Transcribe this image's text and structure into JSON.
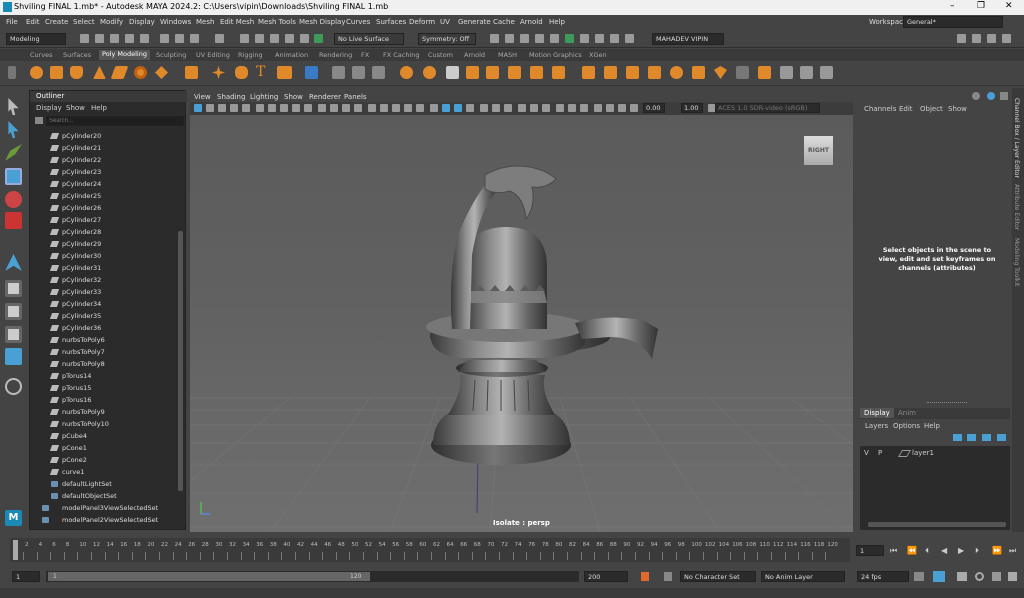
{
  "window": {
    "title": "Shviling FINAL 1.mb* - Autodesk MAYA 2024.2: C:\\Users\\vipin\\Downloads\\Shviling FINAL 1.mb",
    "minimize": "–",
    "maximize": "❐",
    "close": "✕"
  },
  "menu": [
    "File",
    "Edit",
    "Create",
    "Select",
    "Modify",
    "Display",
    "Windows",
    "Mesh",
    "Edit Mesh",
    "Mesh Tools",
    "Mesh Display",
    "Curves",
    "Surfaces",
    "Deform",
    "UV",
    "Generate",
    "Cache",
    "Arnold",
    "Help"
  ],
  "workspace": {
    "label": "Workspace:",
    "value": "General*"
  },
  "statusline": {
    "mode": "Modeling",
    "live_surface": "No Live Surface",
    "symmetry": "Symmetry: Off",
    "user": "MAHADEV VIPIN"
  },
  "shelf_tabs": [
    "Curves",
    "Surfaces",
    "Poly Modeling",
    "Sculpting",
    "UV Editing",
    "Rigging",
    "Animation",
    "Rendering",
    "FX",
    "FX Caching",
    "Custom",
    "Arnold",
    "MASH",
    "Motion Graphics",
    "XGen"
  ],
  "active_shelf": "Poly Modeling",
  "outliner": {
    "title": "Outliner",
    "menu": [
      "Display",
      "Show",
      "Help"
    ],
    "search_placeholder": "Search...",
    "items": [
      "pCylinder20",
      "pCylinder21",
      "pCylinder22",
      "pCylinder23",
      "pCylinder24",
      "pCylinder25",
      "pCylinder26",
      "pCylinder27",
      "pCylinder28",
      "pCylinder29",
      "pCylinder30",
      "pCylinder31",
      "pCylinder32",
      "pCylinder33",
      "pCylinder34",
      "pCylinder35",
      "pCylinder36",
      "nurbsToPoly6",
      "nurbsToPoly7",
      "nurbsToPoly8",
      "pTorus14",
      "pTorus15",
      "pTorus16",
      "nurbsToPoly9",
      "nurbsToPoly10",
      "pCube4",
      "pCone1",
      "pCone2",
      "curve1",
      "defaultLightSet",
      "defaultObjectSet",
      "modelPanel3ViewSelectedSet",
      "modelPanel2ViewSelectedSet"
    ]
  },
  "viewport": {
    "menu": [
      "View",
      "Shading",
      "Lighting",
      "Show",
      "Renderer",
      "Panels"
    ],
    "exposure": "0.00",
    "gamma": "1.00",
    "color_space": "ACES 1.0 SDR-video (sRGB)",
    "view_cube_label": "RIGHT",
    "isolate_label": "Isolate : persp"
  },
  "channel_box": {
    "menu": [
      "Channels",
      "Edit",
      "Object",
      "Show"
    ],
    "empty_message": "Select objects in the scene to view, edit and set keyframes on channels (attributes)"
  },
  "side_tabs": [
    "Channel Box / Layer Editor",
    "Attribute Editor",
    "Modeling Toolkit"
  ],
  "layer_editor": {
    "tabs": [
      "Display",
      "Anim"
    ],
    "active_tab": "Display",
    "menu": [
      "Layers",
      "Options",
      "Help"
    ],
    "layers": [
      {
        "v": "V",
        "p": "P",
        "name": "layer1"
      }
    ]
  },
  "timeline": {
    "ticks": [
      "2",
      "4",
      "6",
      "8",
      "10",
      "12",
      "14",
      "16",
      "18",
      "20",
      "22",
      "24",
      "26",
      "28",
      "30",
      "32",
      "34",
      "36",
      "38",
      "40",
      "42",
      "44",
      "46",
      "48",
      "50",
      "52",
      "54",
      "56",
      "58",
      "60",
      "62",
      "64",
      "66",
      "68",
      "70",
      "72",
      "74",
      "76",
      "78",
      "80",
      "82",
      "84",
      "86",
      "88",
      "90",
      "92",
      "94",
      "96",
      "98",
      "100",
      "102",
      "104",
      "106",
      "108",
      "110",
      "112",
      "114",
      "116",
      "118",
      "120"
    ],
    "current_frame": "1"
  },
  "range": {
    "start": "1",
    "inner_start": "1",
    "inner_end": "120",
    "end": "200",
    "character_set": "No Character Set",
    "anim_layer": "No Anim Layer",
    "fps": "24 fps"
  },
  "colors": {
    "accent": "#5285a6",
    "orange": "#e0892b",
    "bg": "#444444"
  }
}
